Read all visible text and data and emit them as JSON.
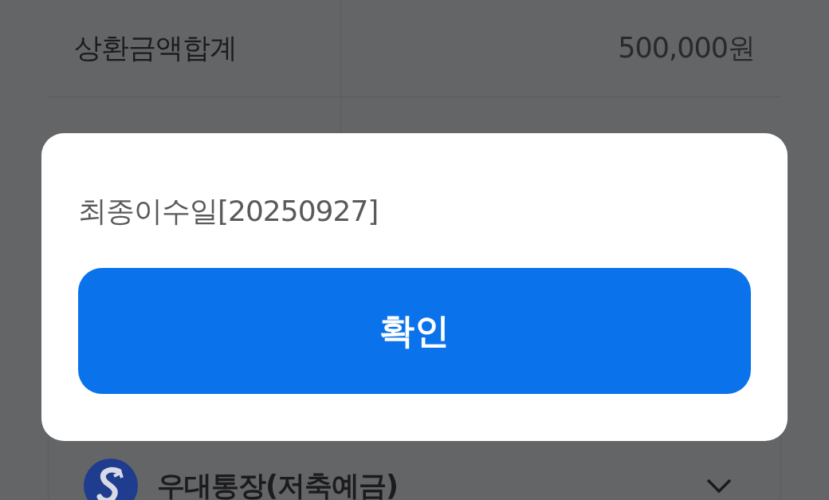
{
  "background": {
    "summary": {
      "label": "상환금액합계",
      "value": "500,000원"
    },
    "account": {
      "name": "우대통장(저축예금)"
    }
  },
  "dialog": {
    "message": "최종이수일[20250927]",
    "buttons": [
      "확인"
    ]
  }
}
